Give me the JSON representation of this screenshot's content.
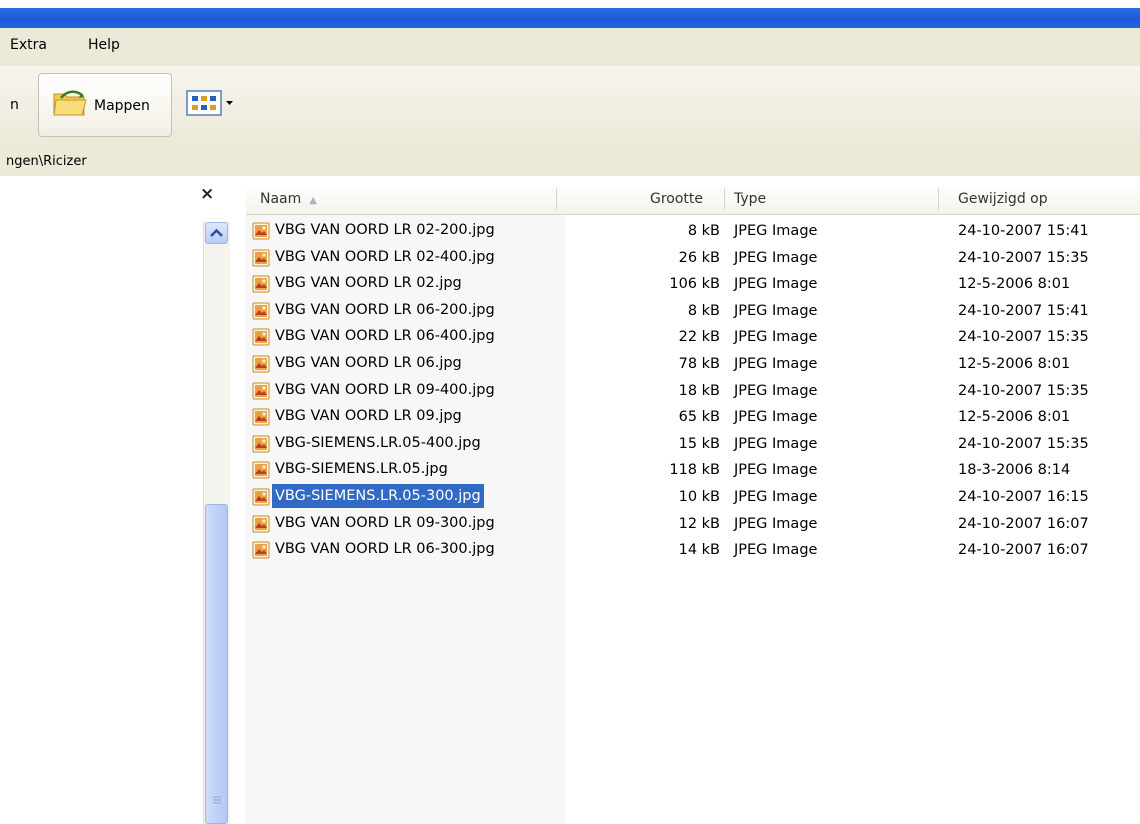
{
  "menu": {
    "items": [
      "Extra",
      "Help"
    ]
  },
  "toolbar": {
    "fragment_label": "n",
    "folders_label": "Mappen"
  },
  "address": {
    "path": "ngen\\Ricizer"
  },
  "left_pane": {
    "close_glyph": "×"
  },
  "columns": {
    "name": "Naam",
    "size": "Grootte",
    "type": "Type",
    "modified": "Gewijzigd op"
  },
  "files": [
    {
      "name": "VBG VAN OORD LR 02-200.jpg",
      "size": "8 kB",
      "type": "JPEG Image",
      "modified": "24-10-2007 15:41"
    },
    {
      "name": "VBG VAN OORD LR 02-400.jpg",
      "size": "26 kB",
      "type": "JPEG Image",
      "modified": "24-10-2007 15:35"
    },
    {
      "name": "VBG VAN OORD LR 02.jpg",
      "size": "106 kB",
      "type": "JPEG Image",
      "modified": "12-5-2006 8:01"
    },
    {
      "name": "VBG VAN OORD LR 06-200.jpg",
      "size": "8 kB",
      "type": "JPEG Image",
      "modified": "24-10-2007 15:41"
    },
    {
      "name": "VBG VAN OORD LR 06-400.jpg",
      "size": "22 kB",
      "type": "JPEG Image",
      "modified": "24-10-2007 15:35"
    },
    {
      "name": "VBG VAN OORD LR 06.jpg",
      "size": "78 kB",
      "type": "JPEG Image",
      "modified": "12-5-2006 8:01"
    },
    {
      "name": "VBG VAN OORD LR 09-400.jpg",
      "size": "18 kB",
      "type": "JPEG Image",
      "modified": "24-10-2007 15:35"
    },
    {
      "name": "VBG VAN OORD LR 09.jpg",
      "size": "65 kB",
      "type": "JPEG Image",
      "modified": "12-5-2006 8:01"
    },
    {
      "name": "VBG-SIEMENS.LR.05-400.jpg",
      "size": "15 kB",
      "type": "JPEG Image",
      "modified": "24-10-2007 15:35"
    },
    {
      "name": "VBG-SIEMENS.LR.05.jpg",
      "size": "118 kB",
      "type": "JPEG Image",
      "modified": "18-3-2006 8:14"
    },
    {
      "name": "VBG-SIEMENS.LR.05-300.jpg",
      "size": "10 kB",
      "type": "JPEG Image",
      "modified": "24-10-2007 16:15",
      "selected": true
    },
    {
      "name": "VBG VAN OORD LR 09-300.jpg",
      "size": "12 kB",
      "type": "JPEG Image",
      "modified": "24-10-2007 16:07"
    },
    {
      "name": "VBG VAN OORD LR 06-300.jpg",
      "size": "14 kB",
      "type": "JPEG Image",
      "modified": "24-10-2007 16:07"
    }
  ],
  "colors": {
    "title_bar": "#1b57d6",
    "selection": "#316ac5",
    "chrome": "#ece9d8"
  }
}
